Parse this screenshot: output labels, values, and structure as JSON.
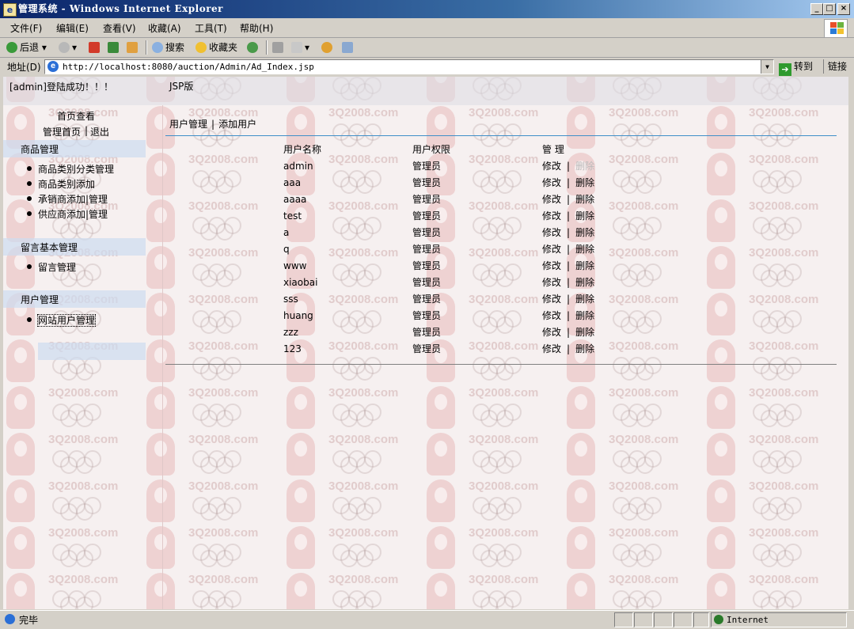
{
  "window": {
    "title": "管理系统 - Windows Internet Explorer",
    "minimize": "_",
    "maximize": "□",
    "close": "×"
  },
  "menu": [
    "文件(F)",
    "编辑(E)",
    "查看(V)",
    "收藏(A)",
    "工具(T)",
    "帮助(H)"
  ],
  "toolbar": {
    "back": "后退",
    "search": "搜索",
    "favorites": "收藏夹"
  },
  "address": {
    "label": "地址(D)",
    "url": "http://localhost:8080/auction/Admin/Ad_Index.jsp",
    "go": "转到",
    "links": "链接"
  },
  "page": {
    "login_message": "[admin]登陆成功！！！",
    "version": "JSP版",
    "sidebar": {
      "home": "首页查看",
      "admin_home": "管理首页",
      "logout": "退出",
      "groups": [
        {
          "title": "商品管理",
          "items": [
            "商品类别分类管理",
            "商品类别添加",
            "承销商添加|管理",
            "供应商添加|管理"
          ]
        },
        {
          "title": "留言基本管理",
          "items": [
            "留言管理"
          ]
        },
        {
          "title": "用户管理",
          "items": [
            "网站用户管理"
          ]
        }
      ]
    },
    "breadcrumb": {
      "current": "用户管理",
      "add": "添加用户"
    },
    "table": {
      "headers": [
        "用户名称",
        "用户权限",
        "管  理"
      ],
      "edit_label": "修改",
      "delete_label": "删除",
      "rows": [
        {
          "name": "admin",
          "role": "管理员"
        },
        {
          "name": "aaa",
          "role": "管理员"
        },
        {
          "name": "aaaa",
          "role": "管理员"
        },
        {
          "name": "test",
          "role": "管理员"
        },
        {
          "name": "a",
          "role": "管理员"
        },
        {
          "name": "q",
          "role": "管理员"
        },
        {
          "name": "www",
          "role": "管理员"
        },
        {
          "name": "xiaobai",
          "role": "管理员"
        },
        {
          "name": "sss",
          "role": "管理员"
        },
        {
          "name": "huang",
          "role": "管理员"
        },
        {
          "name": "zzz",
          "role": "管理员"
        },
        {
          "name": "123",
          "role": "管理员"
        }
      ]
    }
  },
  "status": {
    "text": "完毕",
    "zone": "Internet"
  },
  "watermark": "3Q2008.com"
}
